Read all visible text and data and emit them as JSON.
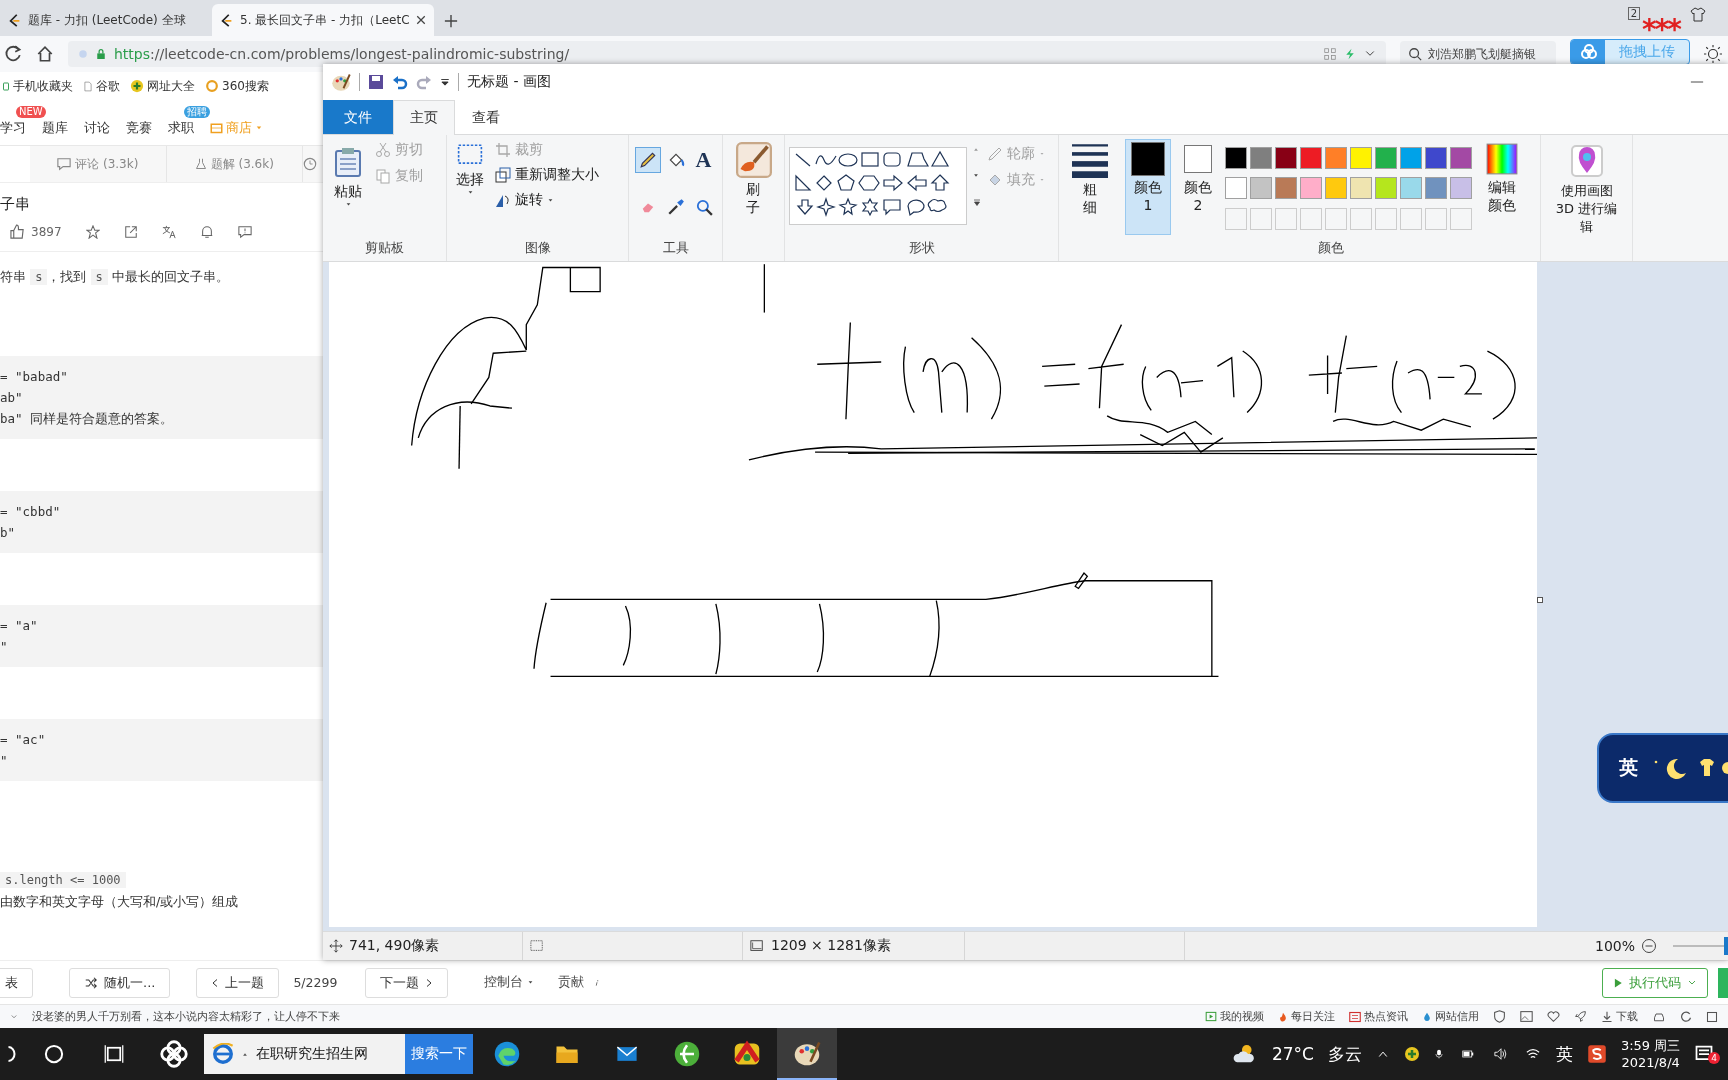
{
  "browser": {
    "tabs": [
      {
        "title": "题库 - 力扣 (LeetCode) 全球",
        "selected": false
      },
      {
        "title": "5. 最长回文子串 - 力扣（LeetC",
        "selected": true
      }
    ],
    "window_count": "2",
    "url": {
      "scheme": "https",
      "rest": "://leetcode-cn.com/problems/longest-palindromic-substring/"
    },
    "search": {
      "value": "刘浩郑鹏飞划艇摘银"
    },
    "upload_button": "拖拽上传",
    "marker": "***",
    "bookmarks": [
      "手机收藏夹",
      "谷歌",
      "网址大全",
      "360搜索"
    ]
  },
  "site": {
    "nav": [
      {
        "label": "学习",
        "badge": "NEW",
        "kind": "link"
      },
      {
        "label": "题库",
        "kind": "link"
      },
      {
        "label": "讨论",
        "kind": "link"
      },
      {
        "label": "竞赛",
        "kind": "link"
      },
      {
        "label": "求职",
        "badge": "招聘",
        "kind": "link"
      },
      {
        "label": "商店",
        "kind": "menu"
      }
    ],
    "tabs": [
      {
        "label": "评论 (3.3k)",
        "kind": "comments",
        "selected": false
      },
      {
        "label": "题解 (3.6k)",
        "kind": "solutions",
        "selected": false
      }
    ],
    "problem": {
      "title": "子串",
      "likes": "3897",
      "description": [
        {
          "kind": "text",
          "text": "符串 "
        },
        {
          "kind": "code",
          "text": "s"
        },
        {
          "kind": "text",
          "text": "，找到 "
        },
        {
          "kind": "code",
          "text": "s"
        },
        {
          "kind": "text",
          "text": " 中最长的回文子串。"
        }
      ],
      "examples": [
        {
          "lines": [
            "= \"babad\"",
            "ab\"",
            "ba\" 同样是符合题意的答案。"
          ]
        },
        {
          "lines": [
            "= \"cbbd\"",
            "b\""
          ]
        },
        {
          "lines": [
            "= \"a\"",
            "\""
          ]
        },
        {
          "lines": [
            "= \"ac\"",
            "\""
          ]
        }
      ],
      "constraints": [
        {
          "kind": "code",
          "text": "s.length <= 1000"
        },
        {
          "kind": "text",
          "text": "由数字和英文字母（大写和/或小写）组成"
        }
      ]
    },
    "footer": [
      {
        "label": "表",
        "kind": "button"
      },
      {
        "label": "随机一...",
        "kind": "shuffle"
      },
      {
        "label": "上一题",
        "kind": "prev"
      },
      {
        "label": "5/2299",
        "kind": "count"
      },
      {
        "label": "下一题",
        "kind": "next"
      },
      {
        "label": "控制台",
        "kind": "menu"
      },
      {
        "label": "贡献",
        "kind": "info"
      }
    ],
    "run_button": "执行代码",
    "status_line": {
      "ad": "没老婆的男人千万别看，这本小说内容太精彩了，让人停不下来",
      "links": [
        "我的视频",
        "每日关注",
        "热点资讯",
        "网站信用"
      ],
      "download": "下载"
    }
  },
  "paint": {
    "title": "无标题 - 画图",
    "tabs": [
      {
        "label": "文件",
        "kind": "file",
        "selected": false
      },
      {
        "label": "主页",
        "kind": "tab",
        "selected": true
      },
      {
        "label": "查看",
        "kind": "tab",
        "selected": false
      }
    ],
    "clipboard": {
      "label": "剪贴板",
      "paste": "粘贴",
      "cut": {
        "label": "剪切",
        "disabled": true
      },
      "copy": {
        "label": "复制",
        "disabled": true
      }
    },
    "image": {
      "label": "图像",
      "select": "选择",
      "crop": {
        "label": "裁剪",
        "disabled": true
      },
      "resize": {
        "label": "重新调整大小",
        "disabled": false
      },
      "rotate": {
        "label": "旋转",
        "disabled": false
      }
    },
    "tools": {
      "label": "工具",
      "items": [
        {
          "kind": "pencil",
          "selected": true
        },
        {
          "kind": "fill",
          "selected": false
        },
        {
          "kind": "text",
          "text": "A",
          "selected": false
        },
        {
          "kind": "eraser",
          "selected": false
        },
        {
          "kind": "picker",
          "selected": false
        },
        {
          "kind": "magnifier",
          "selected": false
        }
      ]
    },
    "brushes": {
      "label": "刷子"
    },
    "shapes": {
      "label": "形状",
      "outline": {
        "label": "轮廓",
        "disabled": true
      },
      "fill": {
        "label": "填充",
        "disabled": true
      }
    },
    "size": {
      "label": "粗细"
    },
    "colors": {
      "label": "颜色",
      "color1": {
        "label": "颜色 1",
        "color": "#000000",
        "selected": true
      },
      "color2": {
        "label": "颜色 2",
        "color": "#ffffff",
        "selected": false
      },
      "palette": [
        {
          "kind": "swatch",
          "color": "#000000"
        },
        {
          "kind": "swatch",
          "color": "#7f7f7f"
        },
        {
          "kind": "swatch",
          "color": "#880015"
        },
        {
          "kind": "swatch",
          "color": "#ed1c24"
        },
        {
          "kind": "swatch",
          "color": "#ff7f27"
        },
        {
          "kind": "swatch",
          "color": "#fff200"
        },
        {
          "kind": "swatch",
          "color": "#22b14c"
        },
        {
          "kind": "swatch",
          "color": "#00a2e8"
        },
        {
          "kind": "swatch",
          "color": "#3f48cc"
        },
        {
          "kind": "swatch",
          "color": "#a349a4"
        },
        {
          "kind": "swatch",
          "color": "#ffffff"
        },
        {
          "kind": "swatch",
          "color": "#c3c3c3"
        },
        {
          "kind": "swatch",
          "color": "#b97a57"
        },
        {
          "kind": "swatch",
          "color": "#ffaec9"
        },
        {
          "kind": "swatch",
          "color": "#ffc90e"
        },
        {
          "kind": "swatch",
          "color": "#efe4b0"
        },
        {
          "kind": "swatch",
          "color": "#b5e61d"
        },
        {
          "kind": "swatch",
          "color": "#99d9ea"
        },
        {
          "kind": "swatch",
          "color": "#7092be"
        },
        {
          "kind": "swatch",
          "color": "#c8bfe7"
        },
        {
          "kind": "empty"
        },
        {
          "kind": "empty"
        },
        {
          "kind": "empty"
        },
        {
          "kind": "empty"
        },
        {
          "kind": "empty"
        },
        {
          "kind": "empty"
        },
        {
          "kind": "empty"
        },
        {
          "kind": "empty"
        },
        {
          "kind": "empty"
        },
        {
          "kind": "empty"
        }
      ],
      "edit": "编辑颜色"
    },
    "paint3d": "使用画图 3D 进行编辑",
    "status": {
      "cursor": "741, 490像素",
      "size": "1209 × 1281像素",
      "zoom": "100%",
      "zoom_slider": {
        "level": 0.5
      }
    }
  },
  "ime_widget": {
    "label": "英"
  },
  "taskbar": {
    "search": {
      "value": "在职研究生招生网"
    },
    "search_button": "搜索一下",
    "weather": {
      "temp": "27°C",
      "desc": "多云"
    },
    "ime": "英",
    "time": "3:59 周三",
    "date": "2021/8/4",
    "notifications": "4"
  }
}
